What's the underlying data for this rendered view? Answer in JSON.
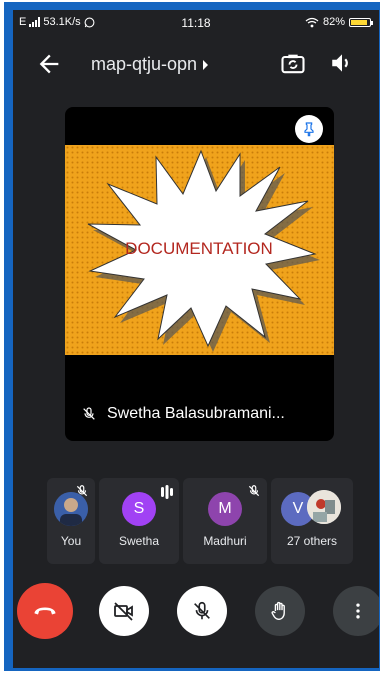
{
  "status_bar": {
    "network_type": "E",
    "speed": "53.1K/s",
    "time": "11:18",
    "battery": "82%",
    "icons": [
      "signal-icon",
      "whatsapp-icon",
      "wifi-icon",
      "battery-icon"
    ]
  },
  "header": {
    "meeting_code": "map-qtju-opn",
    "icons": [
      "back-arrow-icon",
      "chevron-right-icon",
      "switch-camera-icon",
      "speaker-icon"
    ]
  },
  "main_tile": {
    "presenter": "Swetha Balasubramani...",
    "shared_text": "DOCUMENTATION",
    "colors": {
      "burst_bg": "#f0a31c",
      "burst_fill": "#ffffff",
      "text": "#b3271f"
    }
  },
  "participants": [
    {
      "label": "You",
      "avatar": "photo",
      "muted": true
    },
    {
      "label": "Swetha",
      "initial": "S",
      "color": "#a142f4",
      "speaking": true
    },
    {
      "label": "Madhuri",
      "initial": "M",
      "color": "#8e44ad",
      "muted": true
    },
    {
      "label": "27 others",
      "initial": "V",
      "color": "#5c6bc0"
    }
  ],
  "controls": {
    "buttons": [
      "end-call-icon",
      "camera-off-icon",
      "mic-off-icon",
      "raise-hand-icon",
      "more-options-icon"
    ],
    "colors": {
      "end_call": "#ea4335",
      "toggle": "#ffffff",
      "secondary": "#3c4043"
    }
  }
}
